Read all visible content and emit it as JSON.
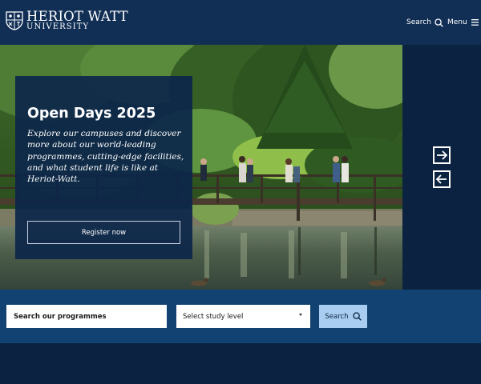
{
  "header": {
    "logo_line1": "HERIOT WATT",
    "logo_line2": "UNIVERSITY",
    "search_label": "Search",
    "menu_label": "Menu"
  },
  "hero": {
    "title": "Open Days 2025",
    "description": "Explore our campuses and discover more about our world-leading programmes, cutting-edge facilities, and what student life is like at Heriot-Watt.",
    "cta_label": "Register now"
  },
  "carousel": {
    "next_icon": "arrow-right-icon",
    "prev_icon": "arrow-left-icon"
  },
  "programme_search": {
    "input_value": "Search our programmes",
    "level_select_value": "Select study level",
    "button_label": "Search"
  },
  "colors": {
    "header_bg": "#112f55",
    "search_band_bg": "#114271",
    "page_bg": "#0b2340",
    "search_button_bg": "#a8cdf0"
  }
}
